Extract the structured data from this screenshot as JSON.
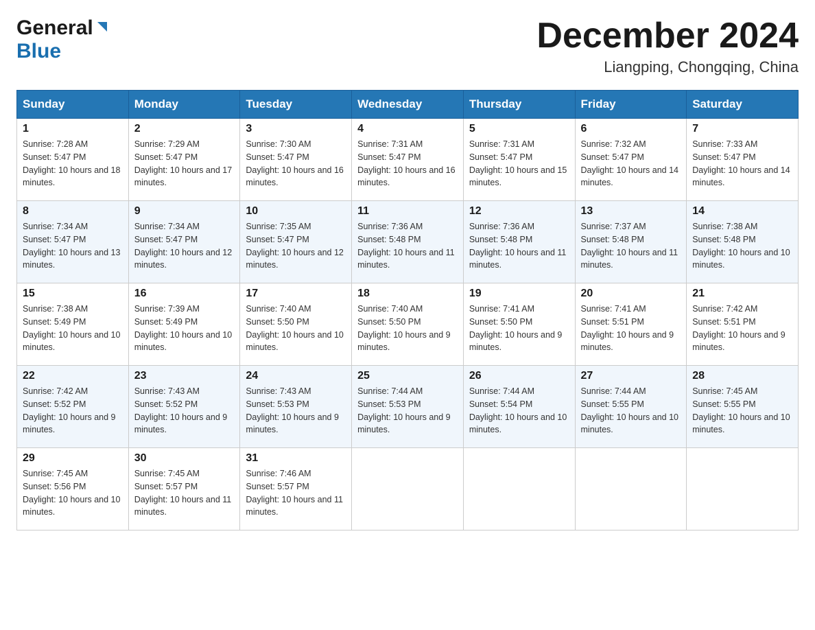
{
  "header": {
    "logo_general": "General",
    "logo_blue": "Blue",
    "month_title": "December 2024",
    "location": "Liangping, Chongqing, China"
  },
  "days_of_week": [
    "Sunday",
    "Monday",
    "Tuesday",
    "Wednesday",
    "Thursday",
    "Friday",
    "Saturday"
  ],
  "weeks": [
    [
      {
        "day": "1",
        "sunrise": "7:28 AM",
        "sunset": "5:47 PM",
        "daylight": "10 hours and 18 minutes."
      },
      {
        "day": "2",
        "sunrise": "7:29 AM",
        "sunset": "5:47 PM",
        "daylight": "10 hours and 17 minutes."
      },
      {
        "day": "3",
        "sunrise": "7:30 AM",
        "sunset": "5:47 PM",
        "daylight": "10 hours and 16 minutes."
      },
      {
        "day": "4",
        "sunrise": "7:31 AM",
        "sunset": "5:47 PM",
        "daylight": "10 hours and 16 minutes."
      },
      {
        "day": "5",
        "sunrise": "7:31 AM",
        "sunset": "5:47 PM",
        "daylight": "10 hours and 15 minutes."
      },
      {
        "day": "6",
        "sunrise": "7:32 AM",
        "sunset": "5:47 PM",
        "daylight": "10 hours and 14 minutes."
      },
      {
        "day": "7",
        "sunrise": "7:33 AM",
        "sunset": "5:47 PM",
        "daylight": "10 hours and 14 minutes."
      }
    ],
    [
      {
        "day": "8",
        "sunrise": "7:34 AM",
        "sunset": "5:47 PM",
        "daylight": "10 hours and 13 minutes."
      },
      {
        "day": "9",
        "sunrise": "7:34 AM",
        "sunset": "5:47 PM",
        "daylight": "10 hours and 12 minutes."
      },
      {
        "day": "10",
        "sunrise": "7:35 AM",
        "sunset": "5:47 PM",
        "daylight": "10 hours and 12 minutes."
      },
      {
        "day": "11",
        "sunrise": "7:36 AM",
        "sunset": "5:48 PM",
        "daylight": "10 hours and 11 minutes."
      },
      {
        "day": "12",
        "sunrise": "7:36 AM",
        "sunset": "5:48 PM",
        "daylight": "10 hours and 11 minutes."
      },
      {
        "day": "13",
        "sunrise": "7:37 AM",
        "sunset": "5:48 PM",
        "daylight": "10 hours and 11 minutes."
      },
      {
        "day": "14",
        "sunrise": "7:38 AM",
        "sunset": "5:48 PM",
        "daylight": "10 hours and 10 minutes."
      }
    ],
    [
      {
        "day": "15",
        "sunrise": "7:38 AM",
        "sunset": "5:49 PM",
        "daylight": "10 hours and 10 minutes."
      },
      {
        "day": "16",
        "sunrise": "7:39 AM",
        "sunset": "5:49 PM",
        "daylight": "10 hours and 10 minutes."
      },
      {
        "day": "17",
        "sunrise": "7:40 AM",
        "sunset": "5:50 PM",
        "daylight": "10 hours and 10 minutes."
      },
      {
        "day": "18",
        "sunrise": "7:40 AM",
        "sunset": "5:50 PM",
        "daylight": "10 hours and 9 minutes."
      },
      {
        "day": "19",
        "sunrise": "7:41 AM",
        "sunset": "5:50 PM",
        "daylight": "10 hours and 9 minutes."
      },
      {
        "day": "20",
        "sunrise": "7:41 AM",
        "sunset": "5:51 PM",
        "daylight": "10 hours and 9 minutes."
      },
      {
        "day": "21",
        "sunrise": "7:42 AM",
        "sunset": "5:51 PM",
        "daylight": "10 hours and 9 minutes."
      }
    ],
    [
      {
        "day": "22",
        "sunrise": "7:42 AM",
        "sunset": "5:52 PM",
        "daylight": "10 hours and 9 minutes."
      },
      {
        "day": "23",
        "sunrise": "7:43 AM",
        "sunset": "5:52 PM",
        "daylight": "10 hours and 9 minutes."
      },
      {
        "day": "24",
        "sunrise": "7:43 AM",
        "sunset": "5:53 PM",
        "daylight": "10 hours and 9 minutes."
      },
      {
        "day": "25",
        "sunrise": "7:44 AM",
        "sunset": "5:53 PM",
        "daylight": "10 hours and 9 minutes."
      },
      {
        "day": "26",
        "sunrise": "7:44 AM",
        "sunset": "5:54 PM",
        "daylight": "10 hours and 10 minutes."
      },
      {
        "day": "27",
        "sunrise": "7:44 AM",
        "sunset": "5:55 PM",
        "daylight": "10 hours and 10 minutes."
      },
      {
        "day": "28",
        "sunrise": "7:45 AM",
        "sunset": "5:55 PM",
        "daylight": "10 hours and 10 minutes."
      }
    ],
    [
      {
        "day": "29",
        "sunrise": "7:45 AM",
        "sunset": "5:56 PM",
        "daylight": "10 hours and 10 minutes."
      },
      {
        "day": "30",
        "sunrise": "7:45 AM",
        "sunset": "5:57 PM",
        "daylight": "10 hours and 11 minutes."
      },
      {
        "day": "31",
        "sunrise": "7:46 AM",
        "sunset": "5:57 PM",
        "daylight": "10 hours and 11 minutes."
      },
      null,
      null,
      null,
      null
    ]
  ]
}
